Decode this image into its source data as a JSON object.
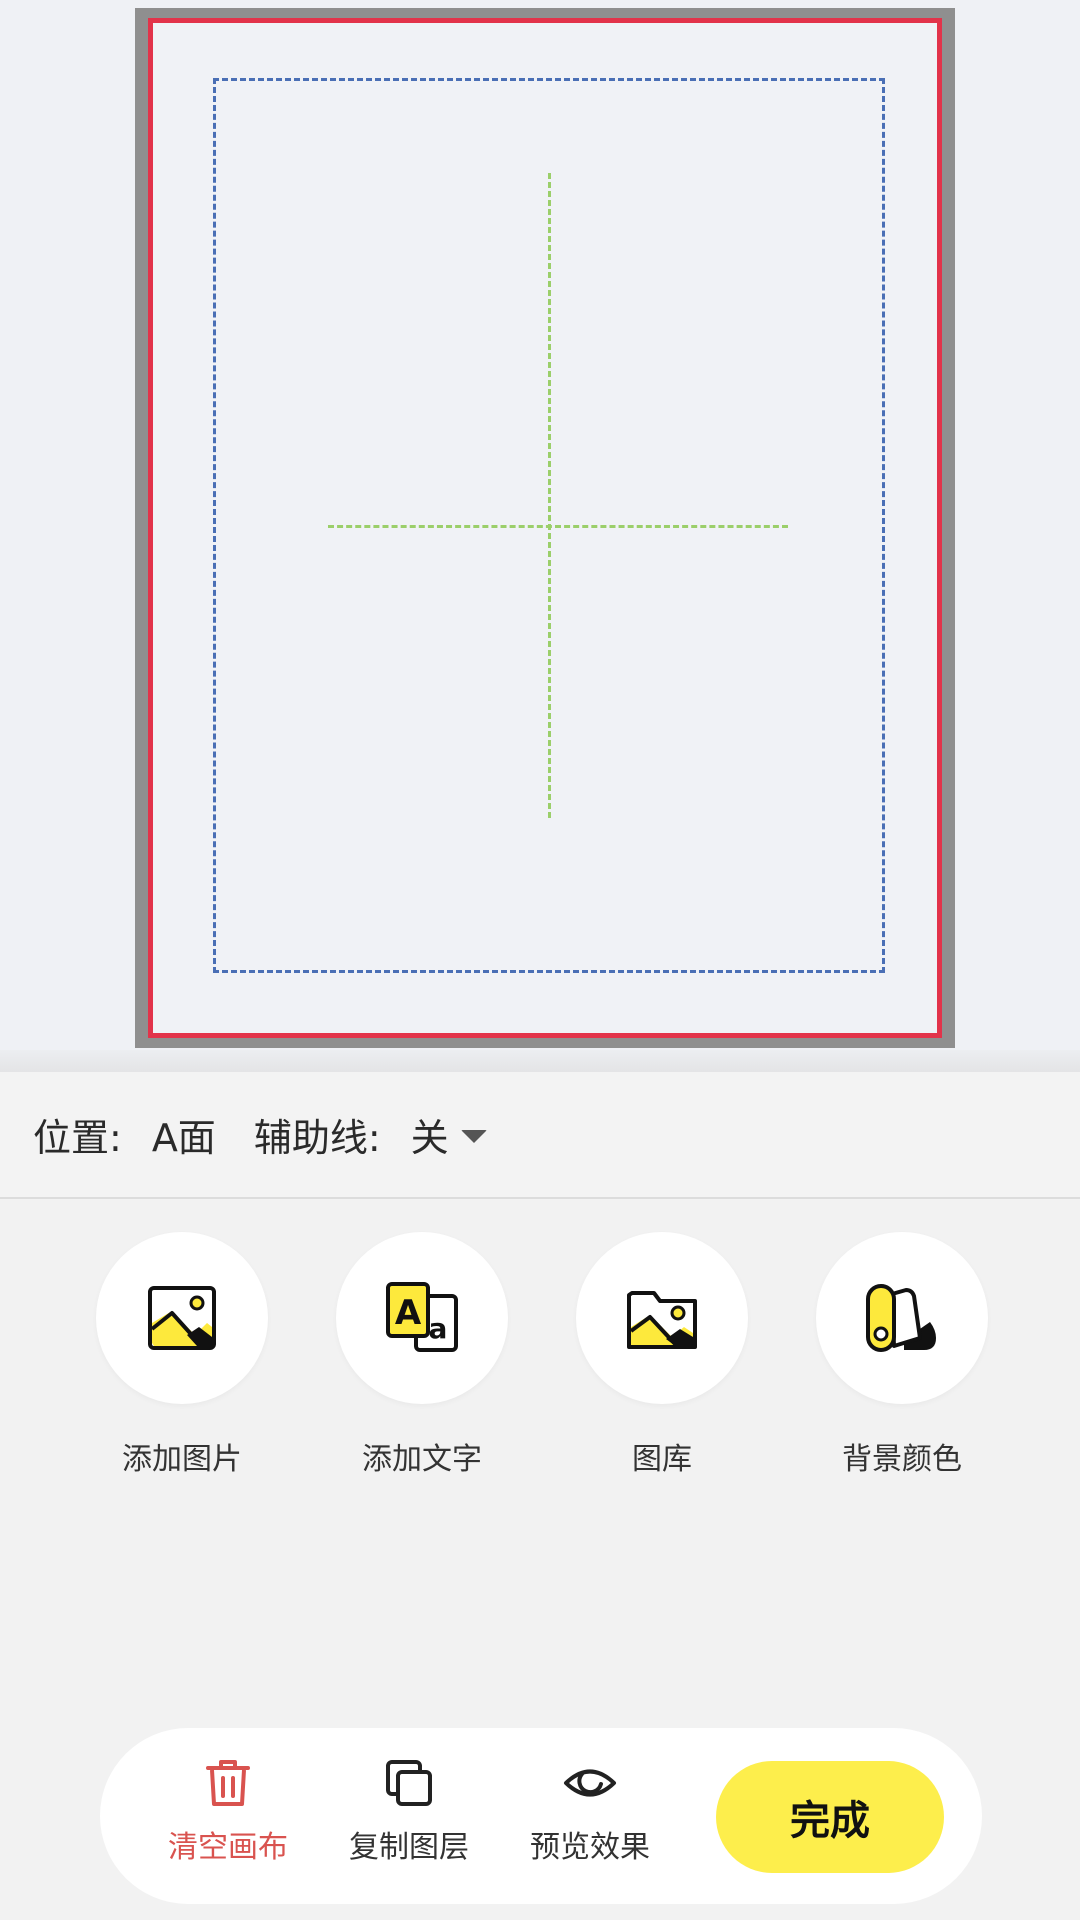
{
  "info_bar": {
    "position_label": "位置:",
    "position_value": "A面",
    "guides_label": "辅助线:",
    "guides_value": "关"
  },
  "tools": [
    {
      "label": "添加图片",
      "icon": "add-image-icon"
    },
    {
      "label": "添加文字",
      "icon": "add-text-icon"
    },
    {
      "label": "图库",
      "icon": "gallery-icon"
    },
    {
      "label": "背景颜色",
      "icon": "palette-icon"
    }
  ],
  "bottom_bar": {
    "clear_label": "清空画布",
    "copy_label": "复制图层",
    "preview_label": "预览效果",
    "done_label": "完成"
  },
  "colors": {
    "accent_yellow": "#fdee4c",
    "danger_red": "#d9534f",
    "bleed_red": "#e2334a",
    "safe_blue": "#4a6fb5",
    "guide_green": "#9bcf6a"
  }
}
